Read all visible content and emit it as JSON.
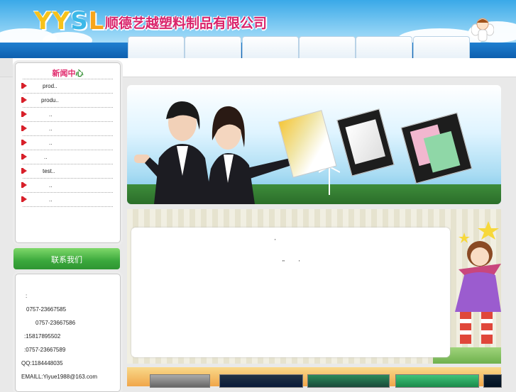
{
  "header": {
    "logo_letters": [
      "Y",
      "Y",
      "S",
      "L"
    ],
    "logo_colors": [
      "#f7c21a",
      "#f7c21a",
      "#3cb8e8",
      "#f7a51a"
    ],
    "company_name": "顺德艺越塑料制品有限公司",
    "nav_tab_count": 6
  },
  "news": {
    "title_parts": [
      {
        "text": "新闻",
        "color": "#e0286b"
      },
      {
        "text": "中",
        "color": "#e0286b"
      },
      {
        "text": "心",
        "color": "#2a8a2a"
      }
    ],
    "items": [
      {
        "label": "prod..",
        "indent": "far"
      },
      {
        "label": "produ..",
        "indent": "mid"
      },
      {
        "label": "..",
        "indent": "deep"
      },
      {
        "label": "..",
        "indent": "deep"
      },
      {
        "label": "..",
        "indent": "deep"
      },
      {
        "label": "..",
        "indent": "near"
      },
      {
        "label": "test..",
        "indent": "mid"
      },
      {
        "label": "..",
        "indent": "deep"
      },
      {
        "label": "..",
        "indent": "deep"
      }
    ]
  },
  "contact": {
    "heading": "联系我们",
    "lines": [
      ":",
      "0757-23667585",
      "0757-23667586",
      ":15817895502",
      ":0757-23667589",
      "QQ:1184448035",
      "EMAILL:Yiyue1988@163.com"
    ]
  },
  "content": {
    "mark1": "'",
    "mark2": "\"",
    "mark3": "'"
  },
  "colors": {
    "nav_blue": "#0d5fae",
    "contact_green": "#3ba83c",
    "bullet_red": "#d8202a",
    "company_pink": "#d9246b"
  }
}
